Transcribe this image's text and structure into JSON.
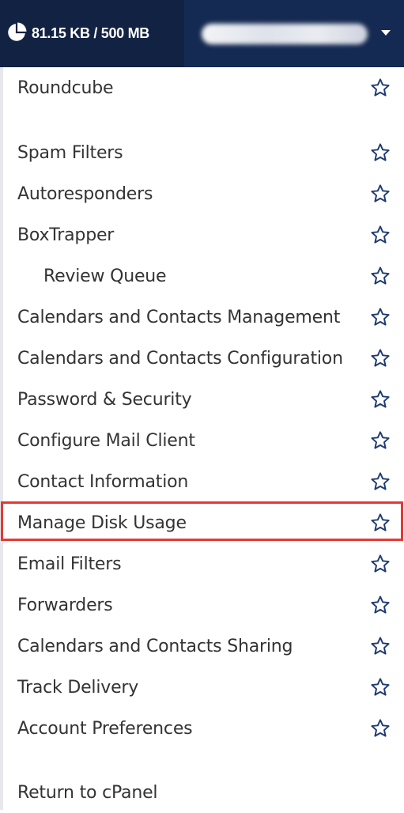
{
  "header": {
    "disk_usage": "81.15 KB / 500 MB",
    "user_email": "",
    "icons": {
      "disk": "pie-chart-icon",
      "caret": "caret-down-icon"
    },
    "colors": {
      "header_bg": "#152a52",
      "disk_bg": "#122243"
    }
  },
  "menu": {
    "items": [
      {
        "label": "Roundcube",
        "favorite_icon": "star-outline-icon"
      },
      {
        "label": "Spam Filters",
        "favorite_icon": "star-outline-icon"
      },
      {
        "label": "Autoresponders",
        "favorite_icon": "star-outline-icon"
      },
      {
        "label": "BoxTrapper",
        "favorite_icon": "star-outline-icon"
      },
      {
        "label": "Review Queue",
        "favorite_icon": "star-outline-icon"
      },
      {
        "label": "Calendars and Contacts Management",
        "favorite_icon": "star-outline-icon"
      },
      {
        "label": "Calendars and Contacts Configuration",
        "favorite_icon": "star-outline-icon"
      },
      {
        "label": "Password & Security",
        "favorite_icon": "star-outline-icon"
      },
      {
        "label": "Configure Mail Client",
        "favorite_icon": "star-outline-icon"
      },
      {
        "label": "Contact Information",
        "favorite_icon": "star-outline-icon"
      },
      {
        "label": "Manage Disk Usage",
        "favorite_icon": "star-outline-icon",
        "highlighted": true
      },
      {
        "label": "Email Filters",
        "favorite_icon": "star-outline-icon"
      },
      {
        "label": "Forwarders",
        "favorite_icon": "star-outline-icon"
      },
      {
        "label": "Calendars and Contacts Sharing",
        "favorite_icon": "star-outline-icon"
      },
      {
        "label": "Track Delivery",
        "favorite_icon": "star-outline-icon"
      },
      {
        "label": "Account Preferences",
        "favorite_icon": "star-outline-icon"
      },
      {
        "label": "Return to cPanel"
      }
    ],
    "colors": {
      "text": "#333333",
      "star": "#1f3b73",
      "highlight_border": "#e53935"
    }
  }
}
